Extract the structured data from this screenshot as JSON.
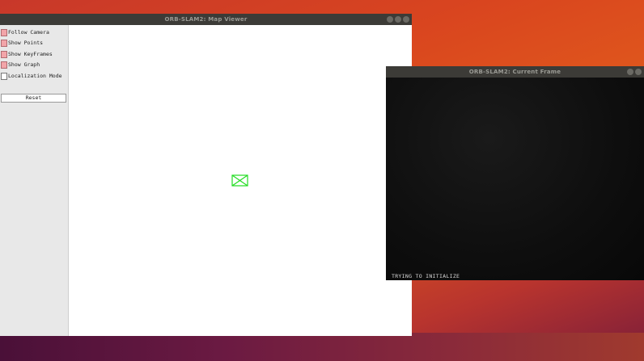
{
  "map_viewer": {
    "title": "ORB-SLAM2: Map Viewer",
    "options": [
      {
        "label": "Follow Camera",
        "checked": true
      },
      {
        "label": "Show Points",
        "checked": true
      },
      {
        "label": "Show KeyFrames",
        "checked": true
      },
      {
        "label": "Show Graph",
        "checked": true
      },
      {
        "label": "Localization Mode",
        "checked": false
      }
    ],
    "reset_label": "Reset",
    "camera_color": "#22dd22"
  },
  "current_frame": {
    "title": "ORB-SLAM2: Current Frame",
    "status": "TRYING TO INITIALIZE"
  },
  "window_buttons": [
    "minimize-icon",
    "maximize-icon",
    "close-icon"
  ]
}
